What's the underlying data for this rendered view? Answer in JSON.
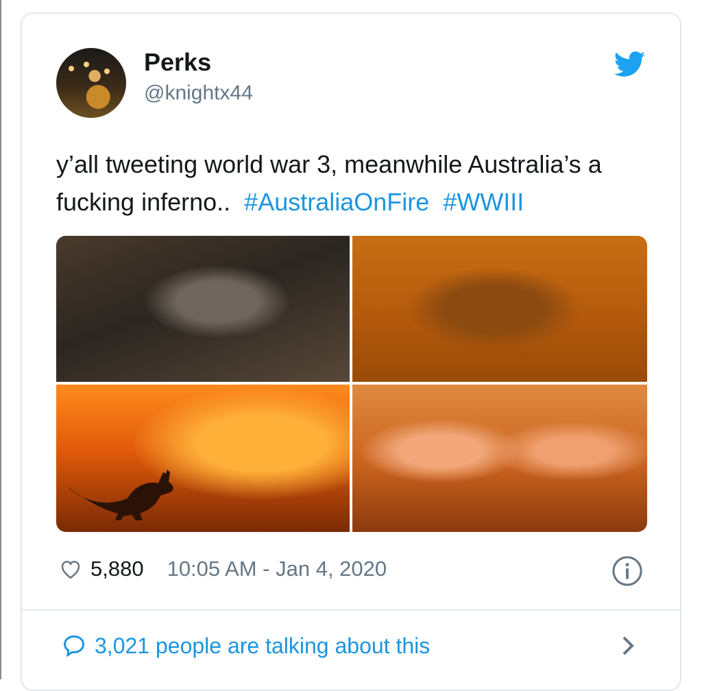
{
  "user": {
    "display_name": "Perks",
    "handle": "@knightx44"
  },
  "tweet": {
    "text": "y’all tweeting world war 3, meanwhile Australia’s a fucking inferno..",
    "hashtags": [
      "#AustraliaOnFire",
      "#WWIII"
    ]
  },
  "media": {
    "photos": [
      {
        "icon": "burnt-koala-photo"
      },
      {
        "icon": "firefighter-photo"
      },
      {
        "icon": "kangaroo-fire-photo"
      },
      {
        "icon": "family-water-photo"
      }
    ]
  },
  "stats": {
    "likes": "5,880",
    "timestamp": "10:05 AM - Jan 4, 2020"
  },
  "footer": {
    "talking_label": "3,021 people are talking about this"
  },
  "colors": {
    "accent": "#1b95e0",
    "text": "#14171a",
    "muted": "#657786",
    "border": "#e1e8ed"
  }
}
